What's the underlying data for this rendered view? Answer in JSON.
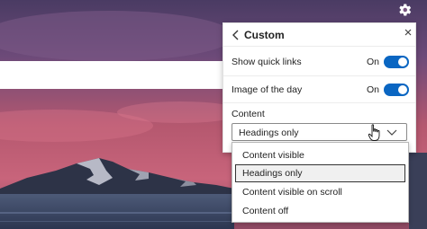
{
  "panel": {
    "title": "Custom",
    "quick_links": {
      "label": "Show quick links",
      "state": "On"
    },
    "image_of_day": {
      "label": "Image of the day",
      "state": "On"
    },
    "content": {
      "label": "Content",
      "selected": "Headings only",
      "options": [
        "Content visible",
        "Headings only",
        "Content visible on scroll",
        "Content off"
      ]
    }
  },
  "colors": {
    "accent": "#0a66c2"
  },
  "icons": {
    "settings": "gear-icon",
    "back": "chevron-left-icon",
    "close": "close-icon",
    "dropdown": "chevron-down-icon",
    "cursor": "hand-pointer-icon"
  }
}
